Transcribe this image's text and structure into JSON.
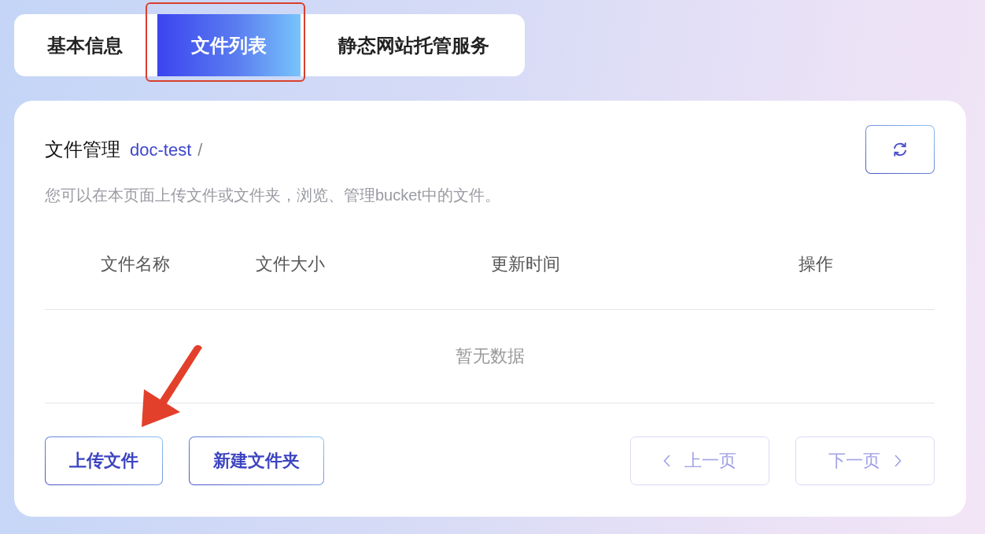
{
  "tabs": [
    {
      "label": "基本信息",
      "selected": false,
      "framed": false
    },
    {
      "label": "文件列表",
      "selected": true,
      "framed": true
    },
    {
      "label": "静态网站托管服务",
      "selected": false,
      "framed": false
    }
  ],
  "file_manager": {
    "title": "文件管理",
    "bucket": "doc-test",
    "path_separator": "/",
    "description": "您可以在本页面上传文件或文件夹，浏览、管理bucket中的文件。"
  },
  "table": {
    "columns": [
      "文件名称",
      "文件大小",
      "更新时间",
      "操作"
    ],
    "empty_text": "暂无数据"
  },
  "actions": [
    {
      "label": "上传文件",
      "arrow": true
    },
    {
      "label": "新建文件夹",
      "arrow": false
    }
  ],
  "pagination": [
    {
      "kind": "prev",
      "label": "上一页",
      "disabled": true
    },
    {
      "kind": "next",
      "label": "下一页",
      "disabled": true
    }
  ]
}
